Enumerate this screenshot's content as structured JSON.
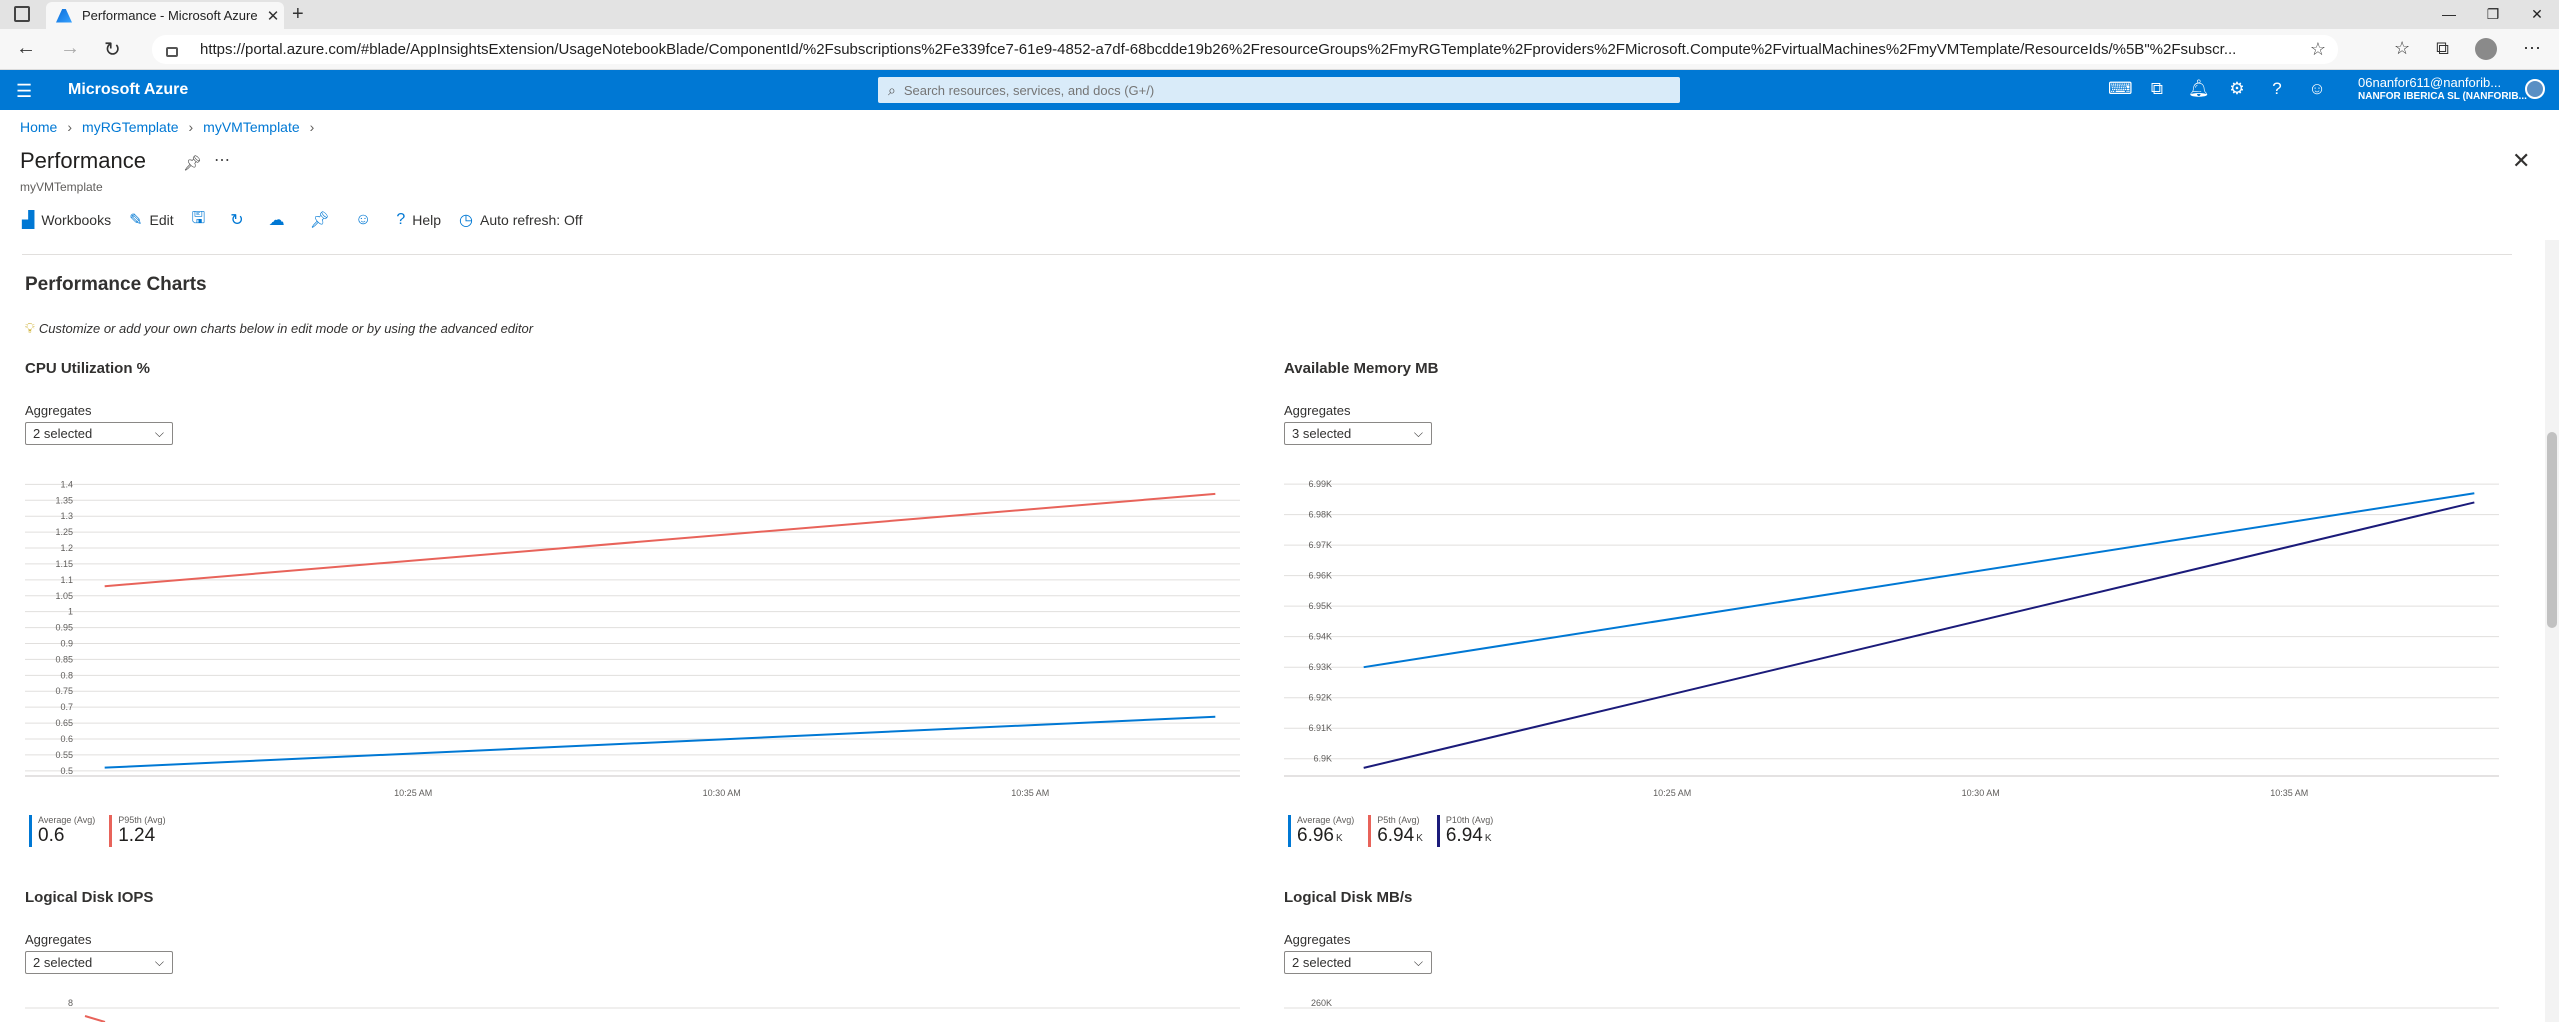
{
  "browser": {
    "tab_title": "Performance - Microsoft Azure",
    "url": "https://portal.azure.com/#blade/AppInsightsExtension/UsageNotebookBlade/ComponentId/%2Fsubscriptions%2Fe339fce7-61e9-4852-a7df-68bcdde19b26%2FresourceGroups%2FmyRGTemplate%2Fproviders%2FMicrosoft.Compute%2FvirtualMachines%2FmyVMTemplate/ResourceIds/%5B\"%2Fsubscr..."
  },
  "azure": {
    "brand": "Microsoft Azure",
    "search_placeholder": "Search resources, services, and docs (G+/)",
    "user_email": "06nanfor611@nanforib...",
    "user_org": "NANFOR IBERICA SL (NANFORIB..."
  },
  "blade": {
    "breadcrumb": [
      "Home",
      "myRGTemplate",
      "myVMTemplate"
    ],
    "title": "Performance",
    "subtitle": "myVMTemplate",
    "toolbar": {
      "workbooks": "Workbooks",
      "edit": "Edit",
      "help": "Help",
      "auto_refresh": "Auto refresh: Off"
    }
  },
  "content": {
    "section_title": "Performance Charts",
    "hint": "Customize or add your own charts below in edit mode or by using the advanced editor",
    "aggregates_label": "Aggregates"
  },
  "panels": [
    {
      "title": "CPU Utilization %",
      "aggregates": "2 selected",
      "legend": [
        {
          "name": "Average (Avg)",
          "value": "0.6",
          "unit": "",
          "color": "#0078d4"
        },
        {
          "name": "P95th (Avg)",
          "value": "1.24",
          "unit": "",
          "color": "#e8635a"
        }
      ]
    },
    {
      "title": "Available Memory MB",
      "aggregates": "3 selected",
      "legend": [
        {
          "name": "Average (Avg)",
          "value": "6.96",
          "unit": "K",
          "color": "#0078d4"
        },
        {
          "name": "P5th (Avg)",
          "value": "6.94",
          "unit": "K",
          "color": "#e8635a"
        },
        {
          "name": "P10th (Avg)",
          "value": "6.94",
          "unit": "K",
          "color": "#1b1b7a"
        }
      ]
    },
    {
      "title": "Logical Disk IOPS",
      "aggregates": "2 selected"
    },
    {
      "title": "Logical Disk MB/s",
      "aggregates": "2 selected"
    }
  ],
  "chart_data": [
    {
      "type": "line",
      "title": "CPU Utilization %",
      "x_ticks": [
        "10:25 AM",
        "10:30 AM",
        "10:35 AM"
      ],
      "y_ticks": [
        "0.5",
        "0.55",
        "0.6",
        "0.65",
        "0.7",
        "0.75",
        "0.8",
        "0.85",
        "0.9",
        "0.95",
        "1",
        "1.05",
        "1.1",
        "1.15",
        "1.2",
        "1.25",
        "1.3",
        "1.35",
        "1.4"
      ],
      "ylim": [
        0.49,
        1.42
      ],
      "grid": true,
      "series": [
        {
          "name": "Average (Avg)",
          "color": "#0078d4",
          "x": [
            "10:20 AM",
            "10:38 AM"
          ],
          "values": [
            0.51,
            0.67
          ]
        },
        {
          "name": "P95th (Avg)",
          "color": "#e8635a",
          "x": [
            "10:20 AM",
            "10:38 AM"
          ],
          "values": [
            1.08,
            1.37
          ]
        }
      ]
    },
    {
      "type": "line",
      "title": "Available Memory MB",
      "x_ticks": [
        "10:25 AM",
        "10:30 AM",
        "10:35 AM"
      ],
      "y_ticks": [
        "6.9K",
        "6.91K",
        "6.92K",
        "6.93K",
        "6.94K",
        "6.95K",
        "6.96K",
        "6.97K",
        "6.98K",
        "6.99K"
      ],
      "ylim": [
        6895,
        6992
      ],
      "grid": true,
      "series": [
        {
          "name": "Average (Avg)",
          "color": "#0078d4",
          "x": [
            "10:20 AM",
            "10:38 AM"
          ],
          "values": [
            6930,
            6987
          ]
        },
        {
          "name": "P10th (Avg)",
          "color": "#1b1b7a",
          "x": [
            "10:20 AM",
            "10:38 AM"
          ],
          "values": [
            6897,
            6984
          ]
        }
      ]
    },
    {
      "type": "line",
      "title": "Logical Disk IOPS",
      "y_ticks": [
        "8"
      ],
      "series": [
        {
          "name": "",
          "color": "#e8635a",
          "values": []
        }
      ]
    },
    {
      "type": "line",
      "title": "Logical Disk MB/s",
      "y_ticks": [
        "260K"
      ],
      "series": []
    }
  ]
}
